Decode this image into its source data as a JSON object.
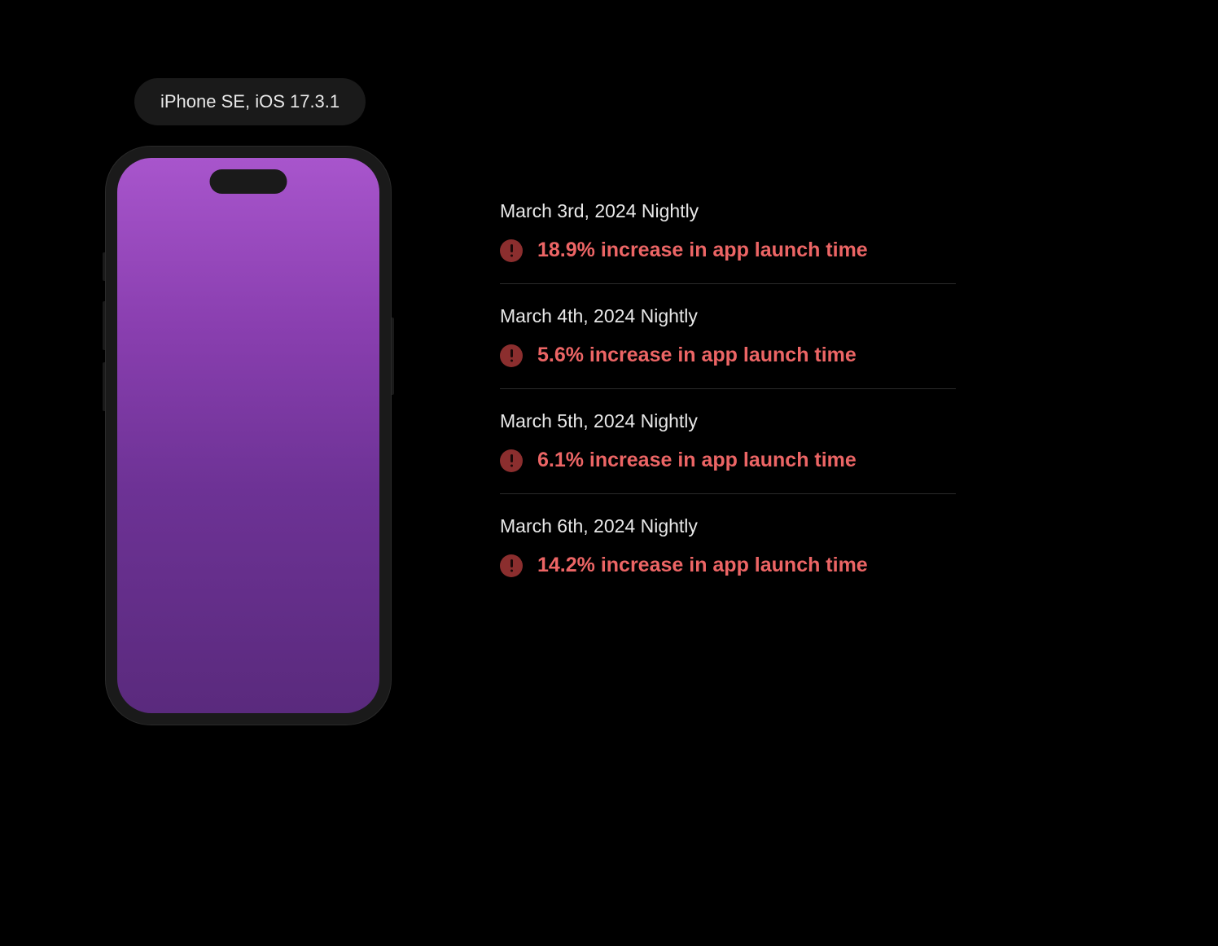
{
  "device": {
    "label": "iPhone SE, iOS 17.3.1"
  },
  "metrics": [
    {
      "date": "March 3rd, 2024 Nightly",
      "alert": "18.9% increase in app launch time"
    },
    {
      "date": "March 4th, 2024 Nightly",
      "alert": "5.6% increase in app launch time"
    },
    {
      "date": "March 5th, 2024 Nightly",
      "alert": "6.1% increase in app launch time"
    },
    {
      "date": "March 6th, 2024 Nightly",
      "alert": "14.2% increase in app launch time"
    }
  ]
}
